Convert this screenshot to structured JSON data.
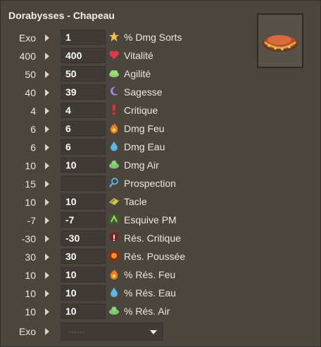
{
  "title": "Dorabysses - Chapeau",
  "item_icon": "hat-icon",
  "stats": [
    {
      "base": "Exo",
      "value": "1",
      "label": "% Dmg Sorts",
      "icon": "star-icon"
    },
    {
      "base": "400",
      "value": "400",
      "label": "Vitalité",
      "icon": "heart-icon"
    },
    {
      "base": "50",
      "value": "50",
      "label": "Agilité",
      "icon": "cloud-icon"
    },
    {
      "base": "40",
      "value": "39",
      "label": "Sagesse",
      "icon": "moon-icon"
    },
    {
      "base": "4",
      "value": "4",
      "label": "Critique",
      "icon": "exclamation-icon"
    },
    {
      "base": "6",
      "value": "6",
      "label": "Dmg Feu",
      "icon": "fire-icon"
    },
    {
      "base": "6",
      "value": "6",
      "label": "Dmg Eau",
      "icon": "water-drop-icon"
    },
    {
      "base": "10",
      "value": "10",
      "label": "Dmg Air",
      "icon": "air-icon"
    },
    {
      "base": "15",
      "value": "",
      "label": "Prospection",
      "icon": "magnifier-icon"
    },
    {
      "base": "10",
      "value": "10",
      "label": "Tacle",
      "icon": "tackle-icon"
    },
    {
      "base": "-7",
      "value": "-7",
      "label": "Esquive PM",
      "icon": "dodge-icon"
    },
    {
      "base": "-30",
      "value": "-30",
      "label": "Rés. Critique",
      "icon": "shield-critical-icon"
    },
    {
      "base": "30",
      "value": "30",
      "label": "Rés. Poussée",
      "icon": "push-resist-icon"
    },
    {
      "base": "10",
      "value": "10",
      "label": "% Rés. Feu",
      "icon": "fire-icon"
    },
    {
      "base": "10",
      "value": "10",
      "label": "% Rés. Eau",
      "icon": "water-drop-icon"
    },
    {
      "base": "10",
      "value": "10",
      "label": "% Rés. Air",
      "icon": "air-icon"
    }
  ],
  "exo_row": {
    "base": "Exo",
    "select_value": "------"
  },
  "colors": {
    "background": "#4b463d",
    "input_bg": "#3f3a33",
    "text": "#ece7dc"
  }
}
